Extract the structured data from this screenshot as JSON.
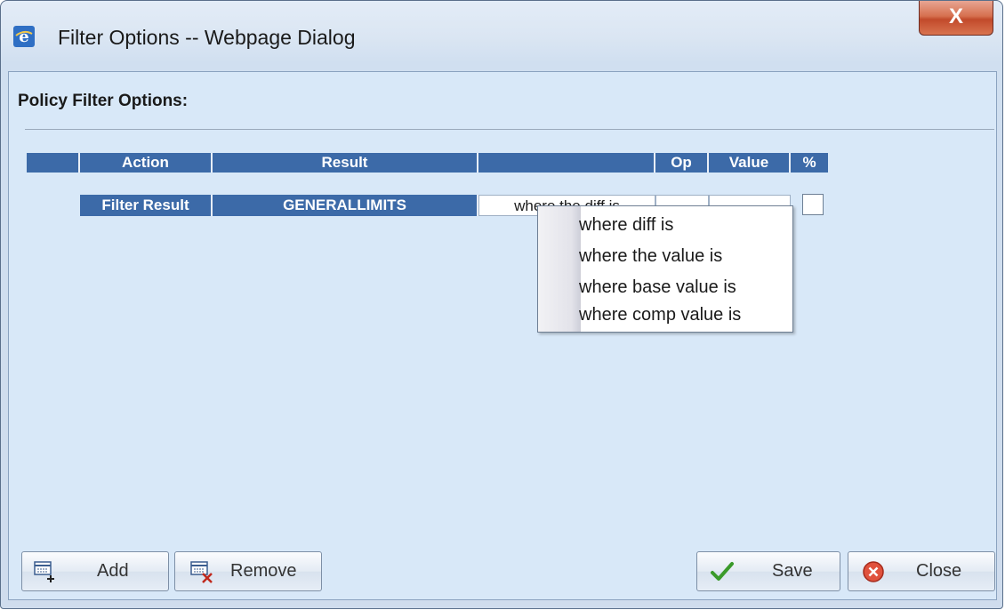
{
  "window": {
    "title": "Filter Options -- Webpage Dialog",
    "close_glyph": "X",
    "icon": "ie-icon"
  },
  "heading": "Policy Filter Options:",
  "table": {
    "columns": [
      "",
      "Action",
      "Result",
      "",
      "Op",
      "Value",
      "%"
    ],
    "row": {
      "action": "Filter Result",
      "result": "GENERALLIMITS",
      "condition": "where the diff is",
      "op": "",
      "value": "",
      "percent_checked": false
    }
  },
  "dropdown": {
    "options": [
      "where diff is",
      "where the value is",
      "where base value is",
      "where comp value is"
    ]
  },
  "buttons": {
    "add": "Add",
    "remove": "Remove",
    "save": "Save",
    "close": "Close"
  },
  "colors": {
    "header_blue": "#3c6aa8",
    "dialog_bg": "#d8e8f8",
    "close_red": "#c24a2b"
  }
}
